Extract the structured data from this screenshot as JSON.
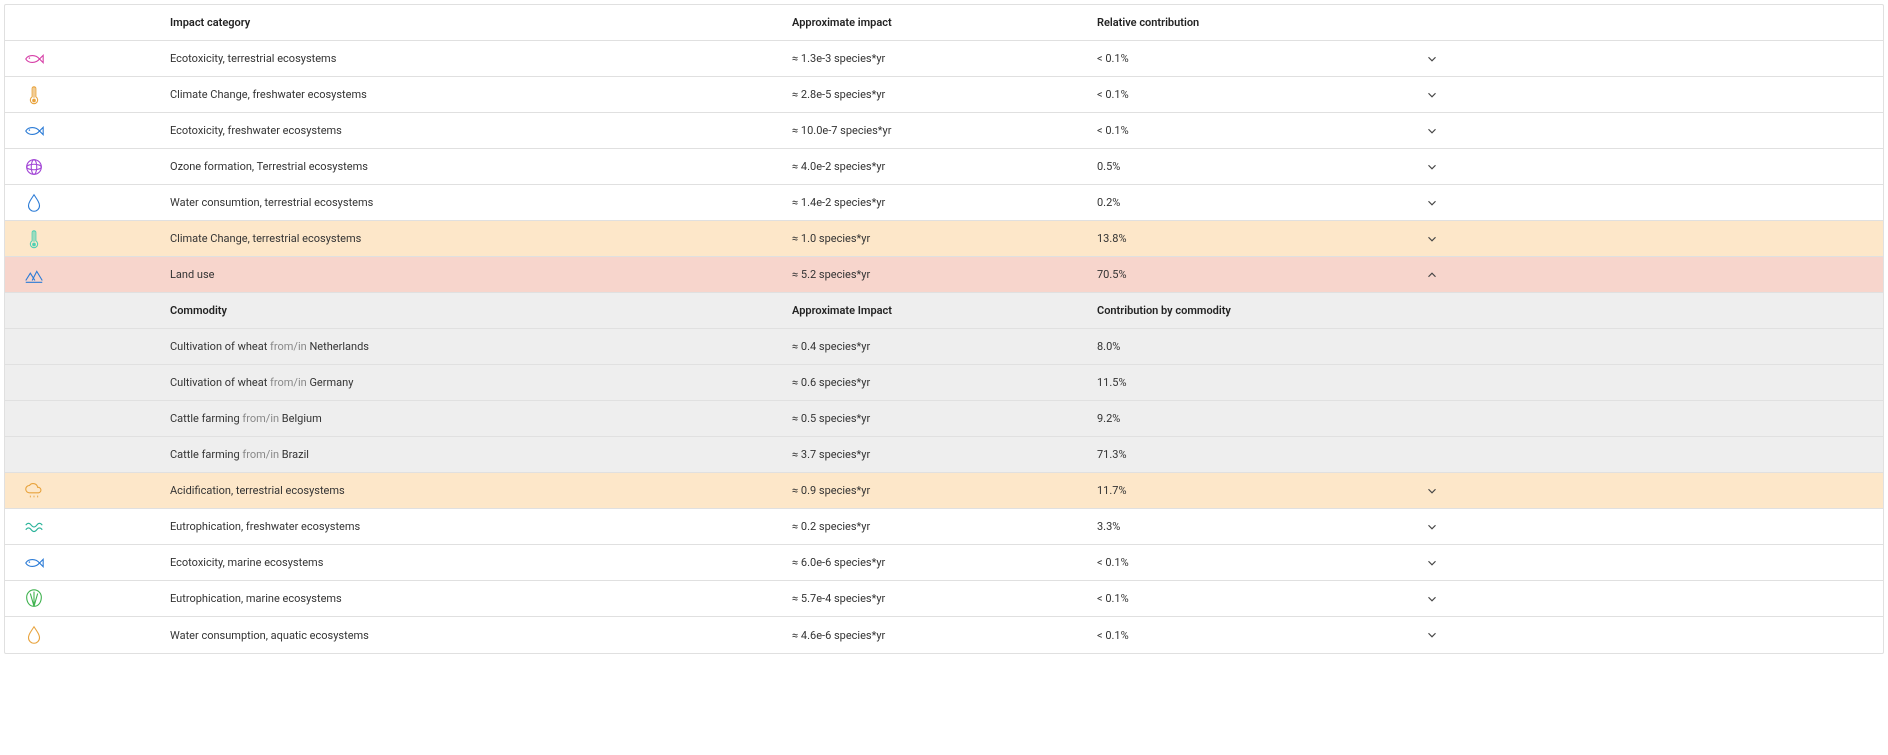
{
  "headers": {
    "category": "Impact category",
    "impact": "Approximate impact",
    "contribution": "Relative contribution"
  },
  "nestedHeaders": {
    "commodity": "Commodity",
    "impact": "Approximate Impact",
    "contribution": "Contribution by commodity"
  },
  "joiner": " from/in ",
  "rows": [
    {
      "icon": "fish-pink",
      "category": "Ecotoxicity, terrestrial ecosystems",
      "impact": "≈ 1.3e-3 species*yr",
      "contribution": "< 0.1%",
      "hl": ""
    },
    {
      "icon": "thermo-orange",
      "category": "Climate Change, freshwater ecosystems",
      "impact": "≈ 2.8e-5 species*yr",
      "contribution": "< 0.1%",
      "hl": ""
    },
    {
      "icon": "fish-blue",
      "category": "Ecotoxicity, freshwater ecosystems",
      "impact": "≈ 10.0e-7 species*yr",
      "contribution": "< 0.1%",
      "hl": ""
    },
    {
      "icon": "globe-purple",
      "category": "Ozone formation, Terrestrial ecosystems",
      "impact": "≈ 4.0e-2 species*yr",
      "contribution": "0.5%",
      "hl": ""
    },
    {
      "icon": "drop-blue",
      "category": "Water consumtion, terrestrial ecosystems",
      "impact": "≈ 1.4e-2 species*yr",
      "contribution": "0.2%",
      "hl": ""
    },
    {
      "icon": "thermo-teal",
      "category": "Climate Change, terrestrial ecosystems",
      "impact": "≈ 1.0 species*yr",
      "contribution": "13.8%",
      "hl": "hl-orange"
    },
    {
      "icon": "land-blue",
      "category": "Land use",
      "impact": "≈ 5.2 species*yr",
      "contribution": "70.5%",
      "hl": "hl-pink",
      "expanded": true,
      "children": [
        {
          "name": "Cultivation of wheat",
          "loc": "Netherlands",
          "impact": "≈ 0.4 species*yr",
          "contribution": "8.0%"
        },
        {
          "name": "Cultivation of wheat",
          "loc": "Germany",
          "impact": "≈ 0.6 species*yr",
          "contribution": "11.5%"
        },
        {
          "name": "Cattle farming",
          "loc": "Belgium",
          "impact": "≈ 0.5 species*yr",
          "contribution": "9.2%"
        },
        {
          "name": "Cattle farming",
          "loc": "Brazil",
          "impact": "≈ 3.7 species*yr",
          "contribution": "71.3%"
        }
      ]
    },
    {
      "icon": "cloud-orange",
      "category": "Acidification, terrestrial ecosystems",
      "impact": "≈ 0.9 species*yr",
      "contribution": "11.7%",
      "hl": "hl-orange"
    },
    {
      "icon": "wave-teal",
      "category": "Eutrophication, freshwater ecosystems",
      "impact": "≈ 0.2 species*yr",
      "contribution": "3.3%",
      "hl": ""
    },
    {
      "icon": "fish-blue",
      "category": "Ecotoxicity, marine ecosystems",
      "impact": "≈ 6.0e-6 species*yr",
      "contribution": "< 0.1%",
      "hl": ""
    },
    {
      "icon": "shell-green",
      "category": "Eutrophication, marine ecosystems",
      "impact": "≈ 5.7e-4 species*yr",
      "contribution": "< 0.1%",
      "hl": ""
    },
    {
      "icon": "drop-orange",
      "category": "Water consumption, aquatic ecosystems",
      "impact": "≈ 4.6e-6 species*yr",
      "contribution": "< 0.1%",
      "hl": ""
    }
  ]
}
